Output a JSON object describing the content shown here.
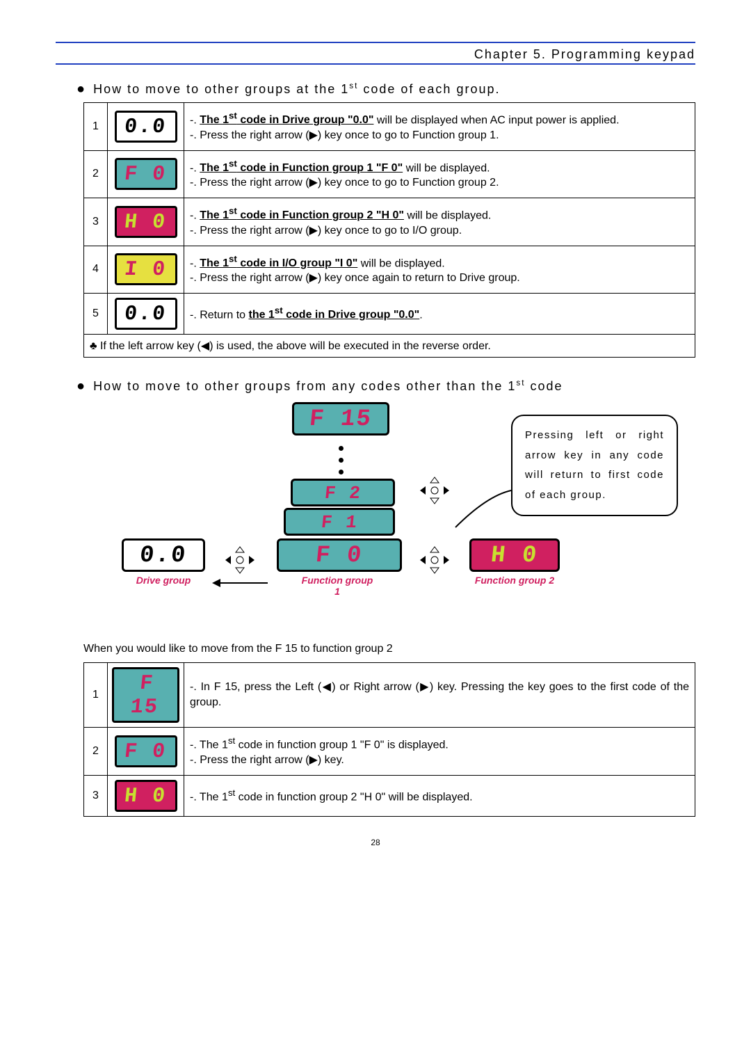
{
  "header": {
    "chapter": "Chapter 5. Programming keypad"
  },
  "section1": {
    "title_pre": "How to move to other groups at the 1",
    "title_sup": "st",
    "title_post": " code of each group."
  },
  "table1": {
    "rows": [
      {
        "num": "1",
        "lcd_text": "0.0",
        "lcd_class": "white",
        "desc_prefix": "-. ",
        "desc_underlined": "The 1<sup>st</sup> code in Drive group \"0.0\"",
        "desc_after": " will be displayed when AC input power is applied.",
        "desc_line2": "-. Press the right arrow (▶) key once to go to Function group 1."
      },
      {
        "num": "2",
        "lcd_text": "F 0",
        "lcd_class": "cyan",
        "desc_prefix": "-. ",
        "desc_underlined": "The 1<sup>st</sup> code in Function group 1 \"F 0\"",
        "desc_after": " will be displayed.",
        "desc_line2": "-. Press the right arrow (▶) key once to go to Function group 2."
      },
      {
        "num": "3",
        "lcd_text": "H 0",
        "lcd_class": "magenta",
        "desc_prefix": "-. ",
        "desc_underlined": "The 1<sup>st</sup> code in Function group 2 \"H 0\"",
        "desc_after": " will be displayed.",
        "desc_line2": "-. Press the right arrow (▶) key once to go to I/O group."
      },
      {
        "num": "4",
        "lcd_text": "I 0",
        "lcd_class": "yellow",
        "desc_prefix": "-. ",
        "desc_underlined": "The 1<sup>st</sup> code in I/O group \"I 0\"",
        "desc_after": " will be displayed.",
        "desc_line2": "-. Press the right arrow (▶) key once again to return to Drive group."
      },
      {
        "num": "5",
        "lcd_text": "0.0",
        "lcd_class": "white",
        "desc_prefix": "-. Return to ",
        "desc_underlined": "the 1<sup>st</sup> code in Drive group \"0.0\"",
        "desc_after": ".",
        "desc_line2": ""
      }
    ],
    "note": "♣ If the left arrow key (◀) is used, the above will be executed in the reverse order."
  },
  "section2": {
    "title_pre": "How to move to other groups from any codes other than the 1",
    "title_sup": "st",
    "title_post": " code"
  },
  "diagram": {
    "f15": "F 15",
    "f2": "F 2",
    "f1": "F 1",
    "f0": "F 0",
    "d00": "0.0",
    "h0": "H 0",
    "label_drive": "Drive group",
    "label_fn1": "Function group 1",
    "label_fn2": "Function group 2",
    "callout": "Pressing left or right arrow key in any code will return to first code of each group."
  },
  "para_lead": "When you would like to move from the F 15 to function group 2",
  "table2": {
    "rows": [
      {
        "num": "1",
        "lcd_text": "F 15",
        "lcd_class": "cyan",
        "desc_html": "-. In F 15, press the Left (◀) or Right arrow (▶) key. Pressing the key goes to the first code of the group."
      },
      {
        "num": "2",
        "lcd_text": "F 0",
        "lcd_class": "cyan",
        "desc_html": "-. The 1<sup>st</sup> code in function group 1 \"F 0\" is displayed.<br>-. Press the right arrow (▶) key."
      },
      {
        "num": "3",
        "lcd_text": "H 0",
        "lcd_class": "magenta",
        "desc_html": "-. The 1<sup>st</sup> code in function group 2 \"H 0\" will be displayed."
      }
    ]
  },
  "page_number": "28"
}
